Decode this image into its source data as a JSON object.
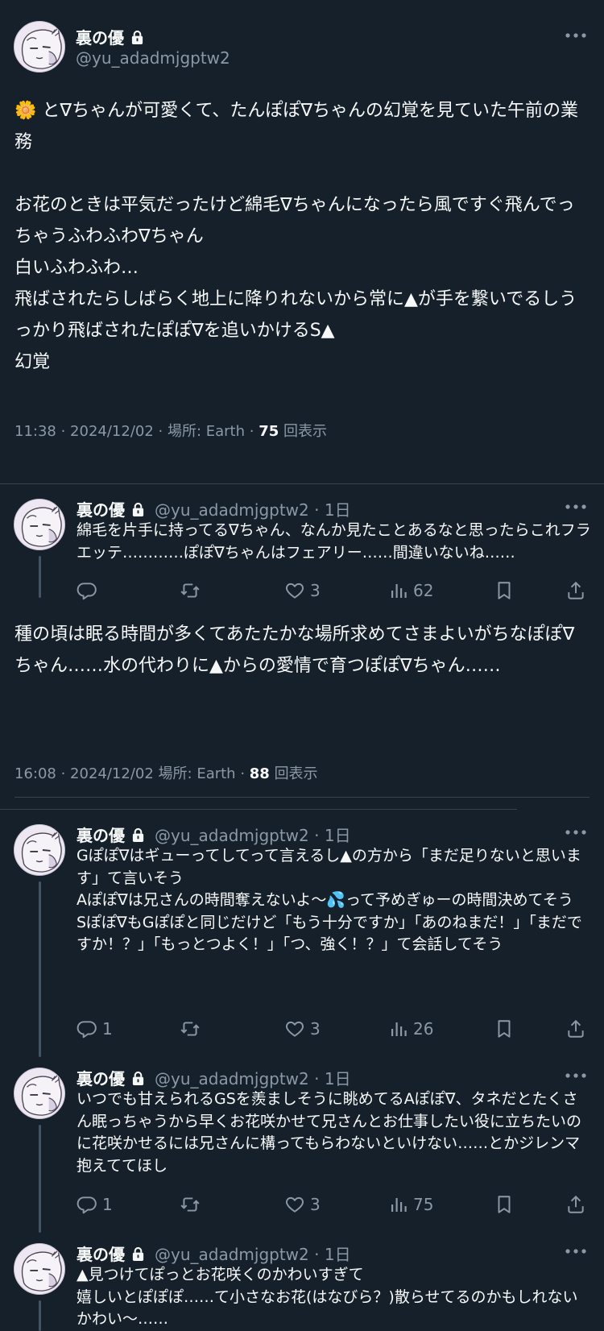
{
  "author": {
    "display_name": "裏の優",
    "handle": "@yu_adadmjgptw2"
  },
  "main_post": {
    "text": "🌼 と∇ちゃんが可愛くて、たんぽぽ∇ちゃんの幻覚を見ていた午前の業務\n\nお花のときは平気だったけど綿毛∇ちゃんになったら風ですぐ飛んでっちゃうふわふわ∇ちゃん\n白いふわふわ…\n飛ばされたらしばらく地上に降りれないから常に▲が手を繋いでるしうっかり飛ばされたぽぽ∇を追いかけるS▲\n幻覚",
    "time": "11:38",
    "date": "2024/12/02",
    "location": "場所: Earth",
    "views": "75",
    "views_label": "回表示"
  },
  "replies": [
    {
      "display_name": "裏の優",
      "handle": "@yu_adadmjgptw2",
      "age": "· 1日",
      "text": "綿毛を片手に持ってる∇ちゃん、なんか見たことあるなと思ったらこれフラエッテ…………ぽぽ∇ちゃんはフェアリー……間違いないね……",
      "replies_count": "",
      "likes": "3",
      "views": "62"
    },
    {
      "display_name": "裏の優",
      "handle": "@yu_adadmjgptw2",
      "age": "· 1日",
      "text": "Gぽぽ∇はギューってしてって言えるし▲の方から「まだ足りないと思います」て言いそう\nAぽぽ∇は兄さんの時間奪えないよ〜💦って予めぎゅーの時間決めてそう\nSぽぽ∇もGぽぽと同じだけど「もう十分ですか」「あのねまだ！」「まだですか！？」「もっとつよく！」「つ、強く！？」て会話してそう",
      "replies_count": "1",
      "likes": "3",
      "views": "26"
    },
    {
      "display_name": "裏の優",
      "handle": "@yu_adadmjgptw2",
      "age": "· 1日",
      "text": "いつでも甘えられるGSを羨ましそうに眺めてるAぽぽ∇、タネだとたくさん眠っちゃうから早くお花咲かせて兄さんとお仕事したい役に立ちたいのに花咲かせるには兄さんに構ってもらわないといけない……とかジレンマ抱えててほし",
      "replies_count": "1",
      "likes": "3",
      "views": "75"
    },
    {
      "display_name": "裏の優",
      "handle": "@yu_adadmjgptw2",
      "age": "· 1日",
      "text": "▲見つけてぽっとお花咲くのかわいすぎて\n嬉しいとぽぽぽ……て小さなお花(はなびら？)散らせてるのかもしれない　かわい〜……"
    }
  ],
  "second_post": {
    "text": "種の頃は眠る時間が多くてあたたかな場所求めてさまよいがちなぽぽ∇ちゃん……水の代わりに▲からの愛情で育つぽぽ∇ちゃん……",
    "time": "16:08",
    "date": "2024/12/02",
    "location": "場所: Earth",
    "views": "88",
    "views_label": "回表示"
  },
  "colors": {
    "background": "#15202b",
    "text": "#f7f9f9",
    "secondary": "#8b98a5",
    "divider": "#38444d"
  },
  "icons": [
    "lock-icon",
    "more-icon",
    "reply-icon",
    "retweet-icon",
    "like-icon",
    "views-icon",
    "bookmark-icon",
    "share-icon"
  ]
}
